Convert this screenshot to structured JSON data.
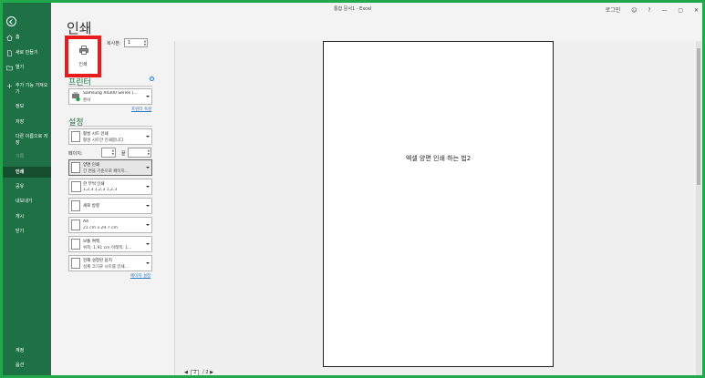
{
  "window": {
    "title": "통합 문서1 - Excel",
    "user": "로그인",
    "help": "?",
    "minimize": "—",
    "restore": "▢",
    "close": "✕",
    "share_glyph": "☺"
  },
  "sidebar": {
    "items": [
      {
        "label": "홈",
        "icon": "home-icon"
      },
      {
        "label": "새로 만들기",
        "icon": "new-document-icon"
      },
      {
        "label": "열기",
        "icon": "open-folder-icon"
      },
      {
        "label": "추가 기능 가져오기",
        "icon": "add-in-icon"
      },
      {
        "label": "정보"
      },
      {
        "label": "저장"
      },
      {
        "label": "다른 이름으로 저장"
      },
      {
        "label": "기록"
      },
      {
        "label": "인쇄"
      },
      {
        "label": "공유"
      },
      {
        "label": "내보내기"
      },
      {
        "label": "게시"
      },
      {
        "label": "닫기"
      }
    ],
    "bottom": [
      {
        "label": "계정"
      },
      {
        "label": "옵션"
      }
    ]
  },
  "print": {
    "heading": "인쇄",
    "print_button_label": "인쇄",
    "copies_label": "복사본:",
    "copies_value": "1",
    "printer_section": "프린터",
    "printer_name": "Samsung X4300 Series (...",
    "printer_status": "준비",
    "printer_properties_link": "프린터 속성",
    "settings_section": "설정",
    "settings": [
      {
        "line1": "활성 시트 인쇄",
        "line2": "활성 시트만 인쇄합니다."
      },
      {
        "line1": "양면 인쇄",
        "line2": "긴 면을 기준으로 페이지..."
      },
      {
        "line1": "한 부씩 인쇄",
        "line2": "1,2,3    1,2,3    1,2,3"
      },
      {
        "line1": "세로 방향",
        "line2": ""
      },
      {
        "line1": "A4",
        "line2": "21 cm x 29.7 cm"
      },
      {
        "line1": "보통 여백",
        "line2": "위쪽: 1.91 cm 아래쪽: 1..."
      },
      {
        "line1": "현재 설정된 용지",
        "line2": "실제 크기로 시트를 인쇄..."
      }
    ],
    "pages_label": "페이지:",
    "to_label": "끝",
    "page_setup_link": "페이지 설정"
  },
  "preview": {
    "content_text": "엑셀 양면 인쇄 하는 법2",
    "current_page": "2",
    "total_pages": "2"
  },
  "colors": {
    "sidebar_bg": "#1e7145",
    "accent": "#1e7145",
    "highlight_border": "#e81c1c",
    "link": "#2b78c5"
  }
}
